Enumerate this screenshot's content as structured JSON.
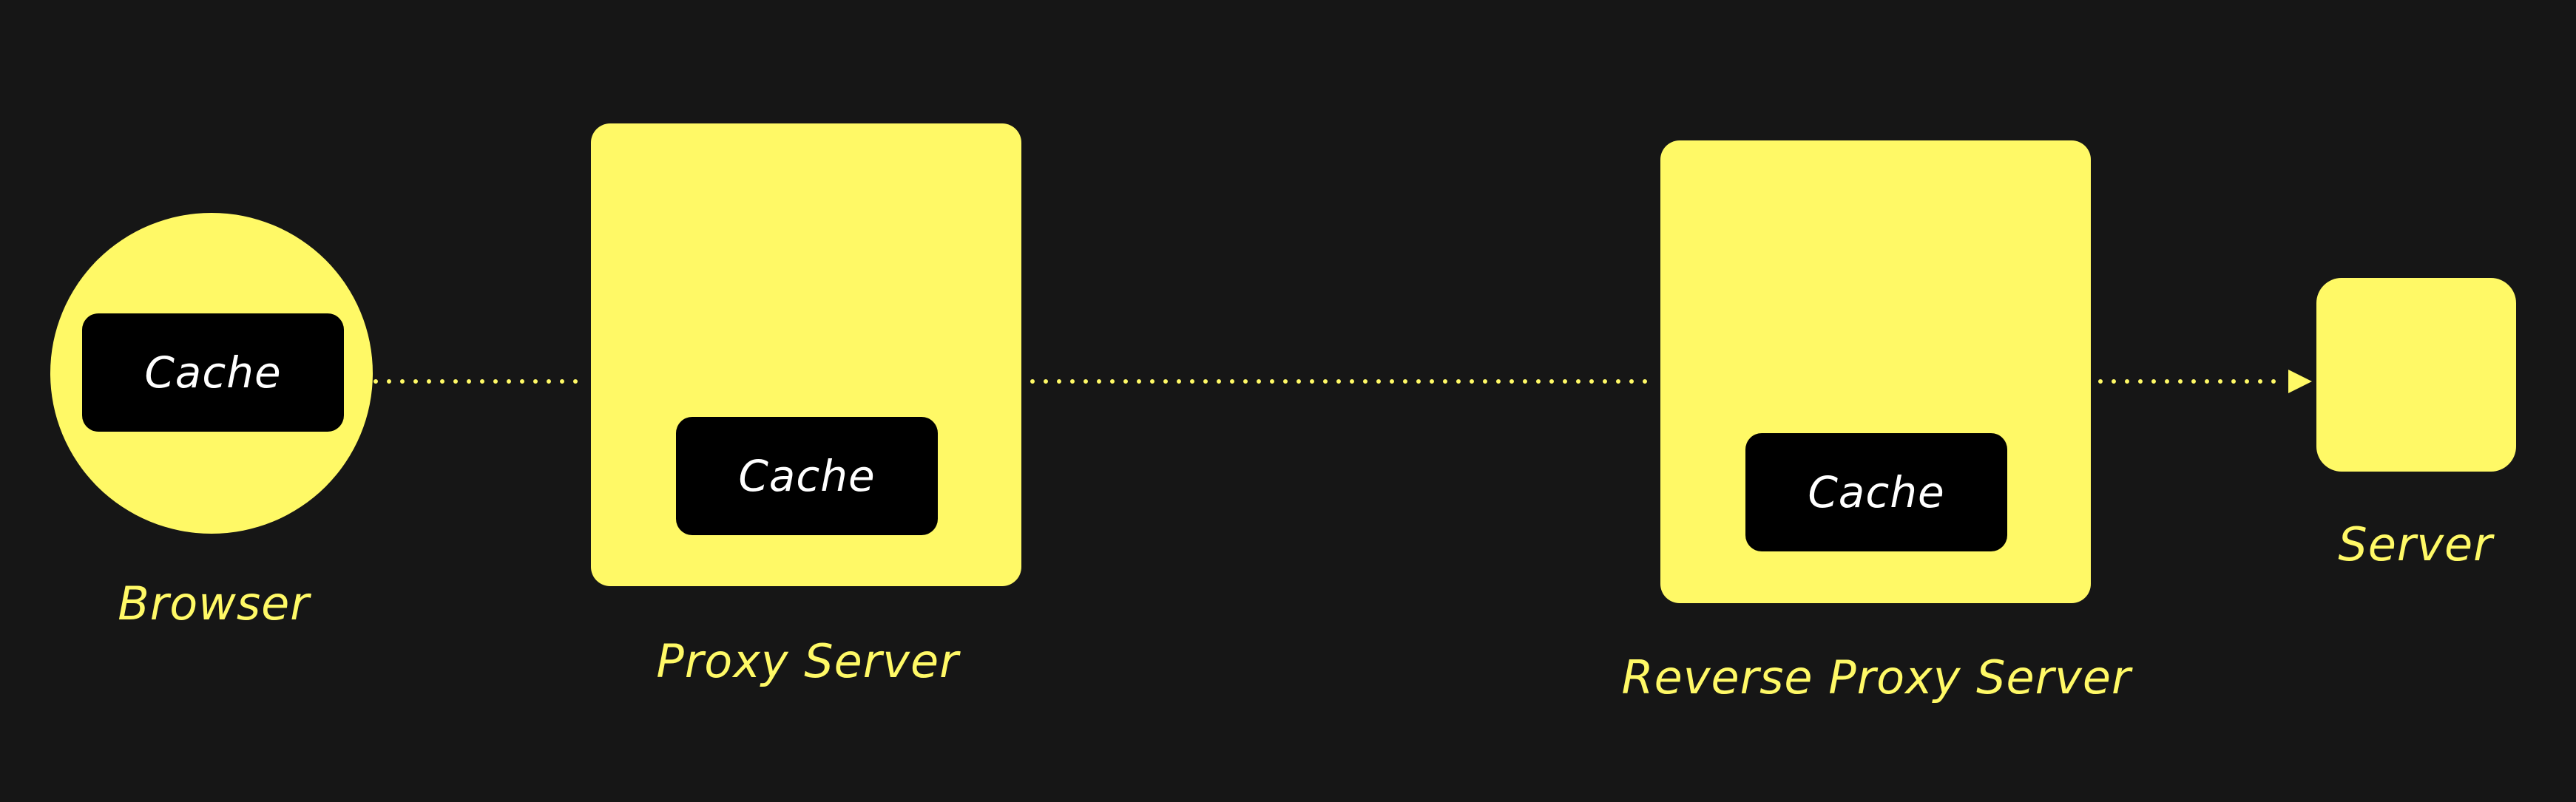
{
  "colors": {
    "background": "#161616",
    "node_fill": "#FFF966",
    "cache_fill": "#000000",
    "cache_text": "#FFFFFF",
    "label_text": "#FFF966",
    "connector": "#FFF966"
  },
  "nodes": {
    "browser": {
      "label": "Browser",
      "cache_label": "Cache"
    },
    "proxy_server": {
      "label": "Proxy Server",
      "cache_label": "Cache"
    },
    "reverse_proxy_server": {
      "label": "Reverse Proxy Server",
      "cache_label": "Cache"
    },
    "server": {
      "label": "Server"
    }
  },
  "edges": [
    {
      "from": "browser",
      "to": "proxy_server",
      "style": "dotted",
      "arrow": false
    },
    {
      "from": "proxy_server",
      "to": "reverse_proxy_server",
      "style": "dotted",
      "arrow": false
    },
    {
      "from": "reverse_proxy_server",
      "to": "server",
      "style": "dotted",
      "arrow": true
    }
  ]
}
